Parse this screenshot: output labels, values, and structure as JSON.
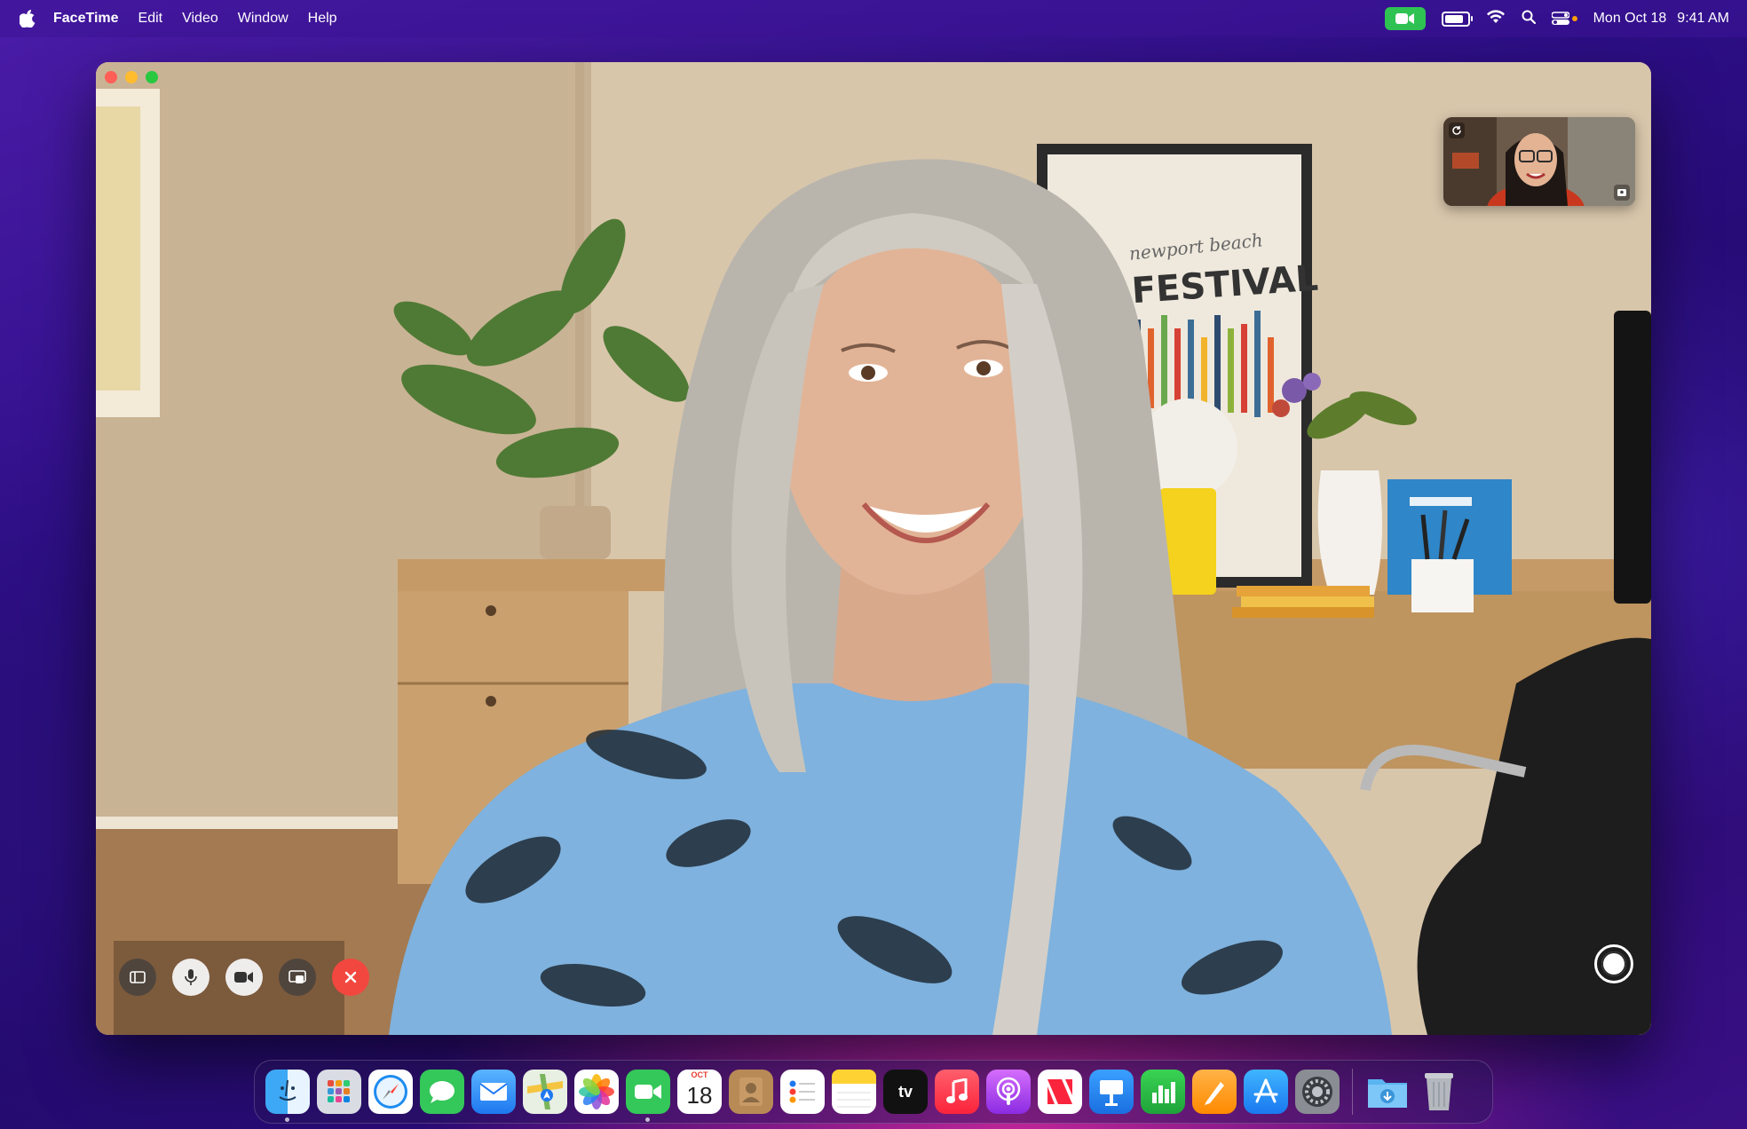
{
  "menubar": {
    "app_name": "FaceTime",
    "menus": [
      "Edit",
      "Video",
      "Window",
      "Help"
    ],
    "date": "Mon Oct 18",
    "time": "9:41 AM",
    "battery_level": 0.85
  },
  "window": {
    "poster": {
      "script_text": "newport beach",
      "title": "JAZZ FESTIVAL"
    }
  },
  "controls": {
    "sidebar": "sidebar-icon",
    "mute": "microphone-icon",
    "camera": "video-camera-icon",
    "share": "screen-share-icon",
    "end": "close-icon",
    "photo": "shutter-icon"
  },
  "dock": {
    "calendar_month": "OCT",
    "calendar_day": "18",
    "apptv_label": "tv",
    "apps": [
      "Finder",
      "Launchpad",
      "Safari",
      "Messages",
      "Mail",
      "Maps",
      "Photos",
      "FaceTime",
      "Calendar",
      "Contacts",
      "Reminders",
      "Notes",
      "TV",
      "Music",
      "Podcasts",
      "News",
      "Keynote",
      "Numbers",
      "Pages",
      "App Store",
      "System Preferences",
      "Downloads",
      "Trash"
    ]
  },
  "colors": {
    "accent_green": "#2fc353",
    "end_call_red": "#f2473f"
  }
}
